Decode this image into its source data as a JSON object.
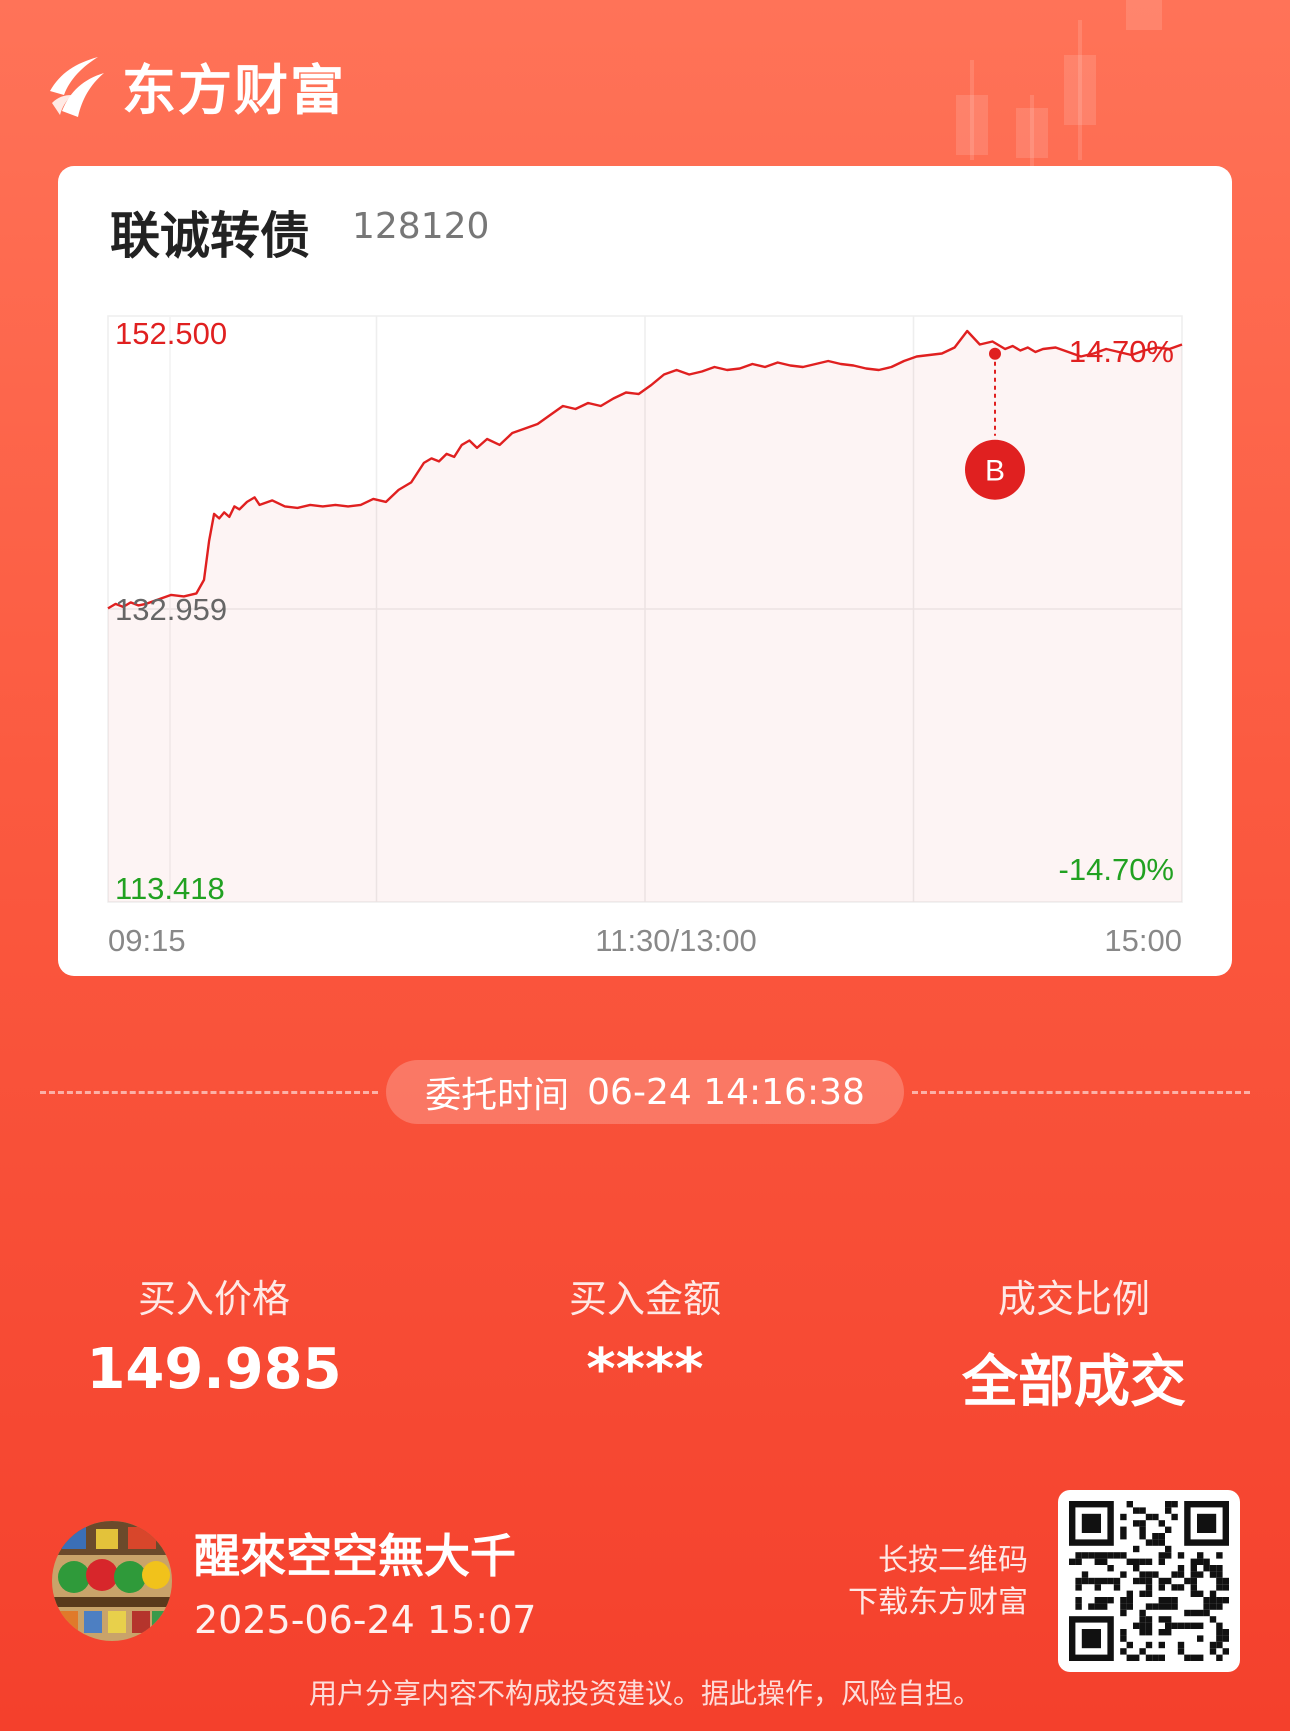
{
  "brand": {
    "name": "东方财富"
  },
  "stock": {
    "name": "联诚转债",
    "code": "128120"
  },
  "chart_data": {
    "type": "line",
    "x_ticks": [
      "09:15",
      "11:30/13:00",
      "15:00"
    ],
    "y_labels": {
      "top": "152.500",
      "mid": "132.959",
      "bottom": "113.418"
    },
    "pct_labels": {
      "top": "14.70%",
      "bottom": "-14.70%"
    },
    "ylim": [
      113.418,
      152.5
    ],
    "prev_close": 132.959,
    "grid": true,
    "x": [
      0,
      3,
      6,
      9,
      12,
      15,
      20,
      25,
      30,
      35,
      38,
      40,
      42,
      44,
      46,
      48,
      50,
      52,
      55,
      58,
      60,
      65,
      70,
      75,
      80,
      85,
      90,
      95,
      100,
      105,
      110,
      115,
      120,
      125,
      128,
      131,
      134,
      137,
      140,
      143,
      146,
      150,
      155,
      160,
      165,
      170,
      175,
      180,
      185,
      190,
      195,
      200,
      205,
      210,
      215,
      220,
      225,
      230,
      235,
      240,
      245,
      250,
      255,
      260,
      265,
      270,
      275,
      280,
      285,
      290,
      295,
      300,
      305,
      310,
      315,
      320,
      325,
      330,
      335,
      340,
      345,
      350,
      355,
      358,
      361,
      364,
      367,
      370,
      375,
      380,
      385,
      390,
      395,
      400,
      405,
      410,
      415,
      420,
      425
    ],
    "series": [
      {
        "values": [
          133.0,
          133.3,
          133.1,
          133.4,
          133.2,
          133.3,
          133.6,
          133.9,
          133.8,
          134.0,
          134.9,
          137.5,
          139.3,
          139.0,
          139.4,
          139.1,
          139.8,
          139.6,
          140.1,
          140.4,
          139.9,
          140.2,
          139.8,
          139.7,
          139.9,
          139.8,
          139.9,
          139.8,
          139.9,
          140.3,
          140.1,
          140.9,
          141.4,
          142.7,
          143.0,
          142.8,
          143.3,
          143.1,
          143.9,
          144.2,
          143.7,
          144.3,
          143.9,
          144.7,
          145.0,
          145.3,
          145.9,
          146.5,
          146.3,
          146.7,
          146.5,
          147.0,
          147.4,
          147.3,
          147.9,
          148.6,
          148.9,
          148.6,
          148.8,
          149.1,
          148.9,
          149.0,
          149.3,
          149.1,
          149.4,
          149.2,
          149.1,
          149.3,
          149.5,
          149.3,
          149.2,
          149.0,
          148.9,
          149.1,
          149.5,
          149.8,
          149.9,
          150.0,
          150.4,
          151.5,
          150.6,
          150.8,
          150.3,
          150.5,
          150.2,
          150.4,
          150.1,
          150.3,
          150.4,
          150.1,
          149.8,
          150.0,
          150.3,
          150.1,
          149.9,
          150.2,
          150.4,
          150.3,
          150.6
        ]
      }
    ],
    "marker": {
      "label": "B",
      "x": 351,
      "value": 149.985
    }
  },
  "delegate": {
    "label": "委托时间",
    "value": "06-24 14:16:38"
  },
  "stats": [
    {
      "label": "买入价格",
      "value": "149.985"
    },
    {
      "label": "买入金额",
      "value": "****"
    },
    {
      "label": "成交比例",
      "value": "全部成交"
    }
  ],
  "user": {
    "name": "醒來空空無大千",
    "datetime": "2025-06-24 15:07"
  },
  "qr": {
    "line1": "长按二维码",
    "line2": "下载东方财富"
  },
  "disclaimer": "用户分享内容不构成投资建议。据此操作，风险自担。",
  "colors": {
    "up": "#e02020",
    "down": "#21a121",
    "neutral": "#666666",
    "accent": "#f4402c"
  }
}
